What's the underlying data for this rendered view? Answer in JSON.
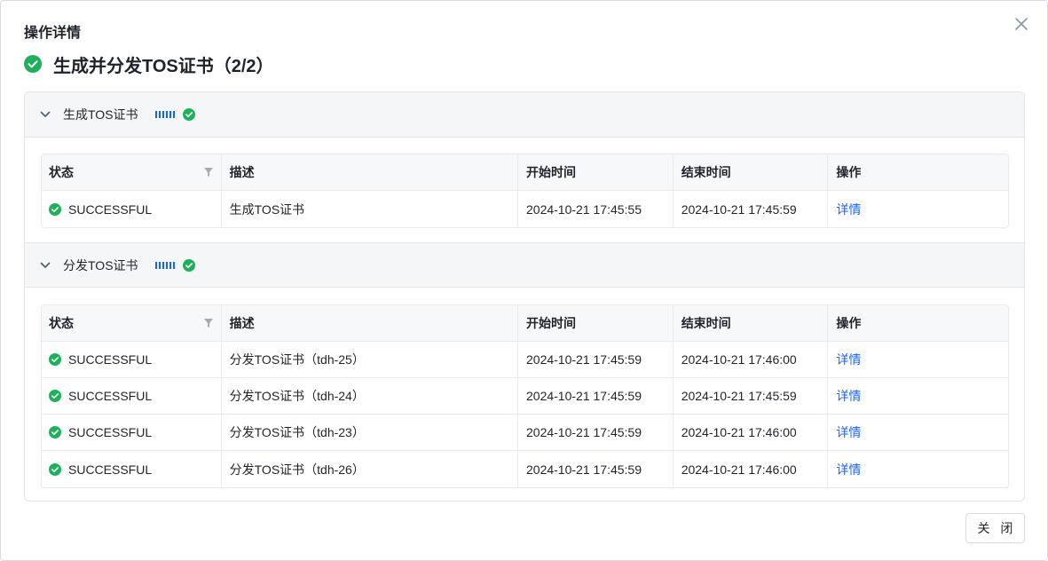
{
  "modal": {
    "title": "操作详情",
    "operation_title": "生成并分发TOS证书（2/2）",
    "close_button": "关 闭"
  },
  "colors": {
    "success": "#1fb05d",
    "link": "#1664ff",
    "progress": "#1664ff"
  },
  "table_headers": {
    "status": "状态",
    "description": "描述",
    "start_time": "开始时间",
    "end_time": "结束时间",
    "action": "操作"
  },
  "steps": [
    {
      "label": "生成TOS证书",
      "rows": [
        {
          "status": "SUCCESSFUL",
          "description": "生成TOS证书",
          "start": "2024-10-21 17:45:55",
          "end": "2024-10-21 17:45:59",
          "action": "详情"
        }
      ]
    },
    {
      "label": "分发TOS证书",
      "rows": [
        {
          "status": "SUCCESSFUL",
          "description": "分发TOS证书（tdh-25）",
          "start": "2024-10-21 17:45:59",
          "end": "2024-10-21 17:46:00",
          "action": "详情"
        },
        {
          "status": "SUCCESSFUL",
          "description": "分发TOS证书（tdh-24）",
          "start": "2024-10-21 17:45:59",
          "end": "2024-10-21 17:45:59",
          "action": "详情"
        },
        {
          "status": "SUCCESSFUL",
          "description": "分发TOS证书（tdh-23）",
          "start": "2024-10-21 17:45:59",
          "end": "2024-10-21 17:46:00",
          "action": "详情"
        },
        {
          "status": "SUCCESSFUL",
          "description": "分发TOS证书（tdh-26）",
          "start": "2024-10-21 17:45:59",
          "end": "2024-10-21 17:46:00",
          "action": "详情"
        }
      ]
    }
  ]
}
